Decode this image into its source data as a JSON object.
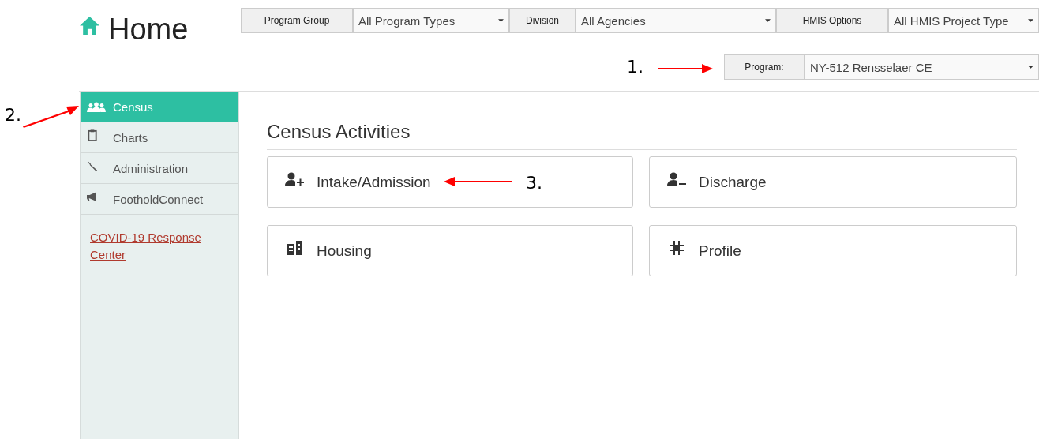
{
  "header": {
    "title": "Home"
  },
  "filters": [
    {
      "label": "Program Group",
      "value": "All Program Types"
    },
    {
      "label": "Division",
      "value": "All Agencies"
    },
    {
      "label": "HMIS Options",
      "value": "All HMIS Project Type"
    }
  ],
  "program_filter": {
    "label": "Program:",
    "value": "NY-512 Rensselaer CE"
  },
  "sidebar": {
    "items": [
      {
        "label": "Census",
        "selected": true
      },
      {
        "label": "Charts",
        "selected": false
      },
      {
        "label": "Administration",
        "selected": false
      },
      {
        "label": "FootholdConnect",
        "selected": false
      }
    ],
    "link": "COVID-19 Response Center"
  },
  "section_title": "Census Activities",
  "cards": [
    {
      "label": "Intake/Admission"
    },
    {
      "label": "Discharge"
    },
    {
      "label": "Housing"
    },
    {
      "label": "Profile"
    }
  ],
  "annotations": [
    "1.",
    "2.",
    "3."
  ]
}
